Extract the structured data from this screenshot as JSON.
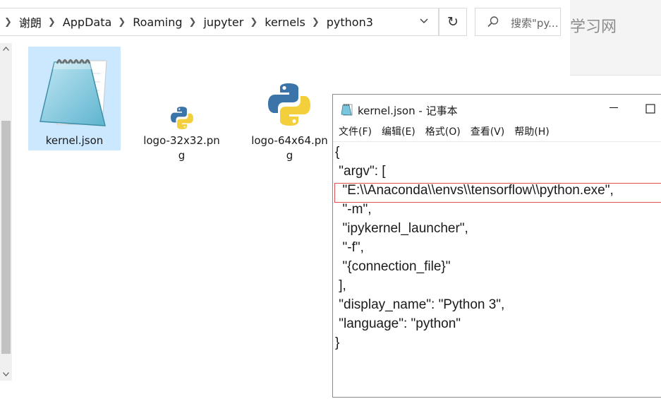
{
  "explorer": {
    "breadcrumbs": [
      "谢朗",
      "AppData",
      "Roaming",
      "jupyter",
      "kernels",
      "python3"
    ],
    "search_placeholder": "搜索\"py...",
    "icons": {
      "breadcrumb_separator": "chevron-right-icon",
      "address_dropdown": "chevron-down-icon",
      "refresh": "refresh-icon",
      "search": "search-icon",
      "scroll_up": "scroll-up-arrow-icon",
      "scroll_down": "scroll-down-arrow-icon"
    },
    "files": [
      {
        "name": "kernel.json",
        "line1": "kernel.json",
        "line2": "",
        "icon": "notepad-file-icon",
        "selected": true
      },
      {
        "name": "logo-32x32.png",
        "line1": "logo-32x32.pn",
        "line2": "g",
        "icon": "python-logo-icon",
        "selected": false
      },
      {
        "name": "logo-64x64.png",
        "line1": "logo-64x64.pn",
        "line2": "g",
        "icon": "python-logo-icon",
        "selected": false
      }
    ]
  },
  "background_page": {
    "partial_text": "学习网"
  },
  "notepad": {
    "title": "kernel.json - 记事本",
    "menus": [
      "文件(F)",
      "编辑(E)",
      "格式(O)",
      "查看(V)",
      "帮助(H)"
    ],
    "icons": {
      "app": "notepad-icon",
      "minimize": "minimize-icon",
      "maximize": "maximize-icon"
    },
    "lines": [
      "{",
      " \"argv\": [",
      "  \"E:\\\\Anaconda\\\\envs\\\\tensorflow\\\\python.exe\",",
      "  \"-m\",",
      "  \"ipykernel_launcher\",",
      "  \"-f\",",
      "  \"{connection_file}\"",
      " ],",
      " \"display_name\": \"Python 3\",",
      " \"language\": \"python\"",
      "}"
    ],
    "highlight_color": "#e05050"
  }
}
